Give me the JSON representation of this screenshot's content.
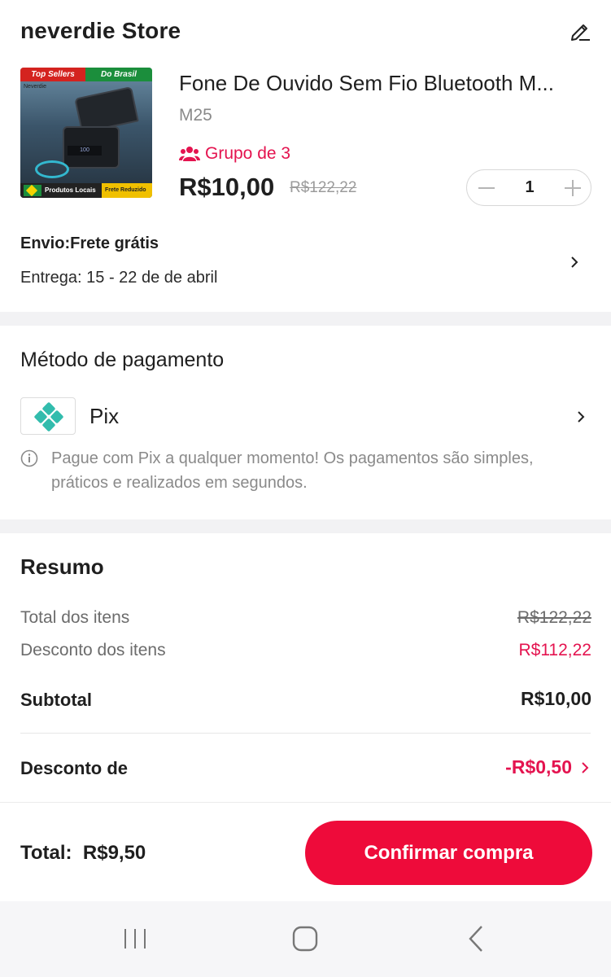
{
  "store": {
    "name": "neverdie Store"
  },
  "product": {
    "thumbnail": {
      "badge_left": "Top Sellers",
      "badge_right": "Do Brasil",
      "brand": "Neverdie",
      "display": "100",
      "footer_left": "Produtos Locais",
      "footer_right": "Frete Reduzido"
    },
    "title": "Fone De Ouvido Sem Fio Bluetooth M...",
    "variant": "M25",
    "group_label": "Grupo de 3",
    "price": "R$10,00",
    "original_price": "R$122,22",
    "quantity": "1"
  },
  "shipping": {
    "title": "Envio:Frete grátis",
    "delivery": "Entrega: 15 - 22 de de abril"
  },
  "payment": {
    "section_title": "Método de pagamento",
    "method_label": "Pix",
    "info_text": "Pague com Pix a qualquer momento! Os pagamentos são simples, práticos e realizados em segundos."
  },
  "summary": {
    "title": "Resumo",
    "items_total_label": "Total dos itens",
    "items_total_value": "R$122,22",
    "items_discount_label": "Desconto dos itens",
    "items_discount_value": "R$112,22",
    "subtotal_label": "Subtotal",
    "subtotal_value": "R$10,00",
    "discount_label": "Desconto de",
    "discount_value": "-R$0,50"
  },
  "footer": {
    "total_label": "Total:",
    "total_value": "R$9,50",
    "confirm_label": "Confirmar compra"
  },
  "colors": {
    "accent": "#ee0b3a",
    "discount_red": "#e4134f",
    "pix_teal": "#32bcad"
  }
}
